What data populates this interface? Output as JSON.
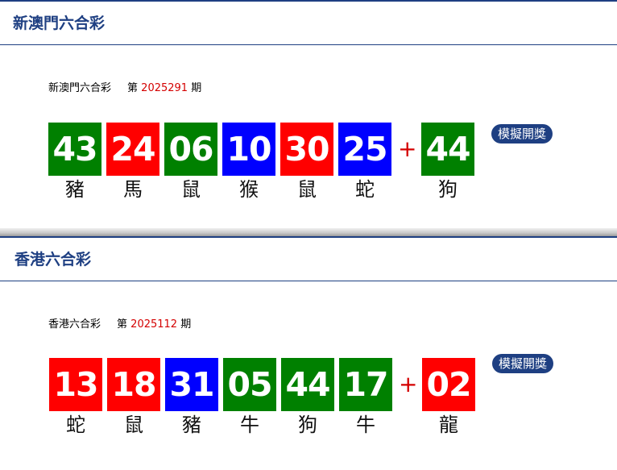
{
  "colors": {
    "red": "#ff0000",
    "green": "#008000",
    "blue": "#0000ff",
    "accent": "#1e3f82",
    "issue_number": "#d40000"
  },
  "sections": [
    {
      "title": "新澳門六合彩",
      "lottery_name": "新澳門六合彩",
      "issue_prefix": "第",
      "issue_number": "2025291",
      "issue_suffix": "期",
      "plus": "+",
      "button_label": "模擬開獎",
      "numbers": [
        {
          "value": "43",
          "zodiac": "豬",
          "color": "green"
        },
        {
          "value": "24",
          "zodiac": "馬",
          "color": "red"
        },
        {
          "value": "06",
          "zodiac": "鼠",
          "color": "green"
        },
        {
          "value": "10",
          "zodiac": "猴",
          "color": "blue"
        },
        {
          "value": "30",
          "zodiac": "鼠",
          "color": "red"
        },
        {
          "value": "25",
          "zodiac": "蛇",
          "color": "blue"
        }
      ],
      "special": {
        "value": "44",
        "zodiac": "狗",
        "color": "green"
      }
    },
    {
      "title": "香港六合彩",
      "lottery_name": "香港六合彩",
      "issue_prefix": "第",
      "issue_number": "2025112",
      "issue_suffix": "期",
      "plus": "+",
      "button_label": "模擬開獎",
      "numbers": [
        {
          "value": "13",
          "zodiac": "蛇",
          "color": "red"
        },
        {
          "value": "18",
          "zodiac": "鼠",
          "color": "red"
        },
        {
          "value": "31",
          "zodiac": "豬",
          "color": "blue"
        },
        {
          "value": "05",
          "zodiac": "牛",
          "color": "green"
        },
        {
          "value": "44",
          "zodiac": "狗",
          "color": "green"
        },
        {
          "value": "17",
          "zodiac": "牛",
          "color": "green"
        }
      ],
      "special": {
        "value": "02",
        "zodiac": "龍",
        "color": "red"
      }
    }
  ]
}
